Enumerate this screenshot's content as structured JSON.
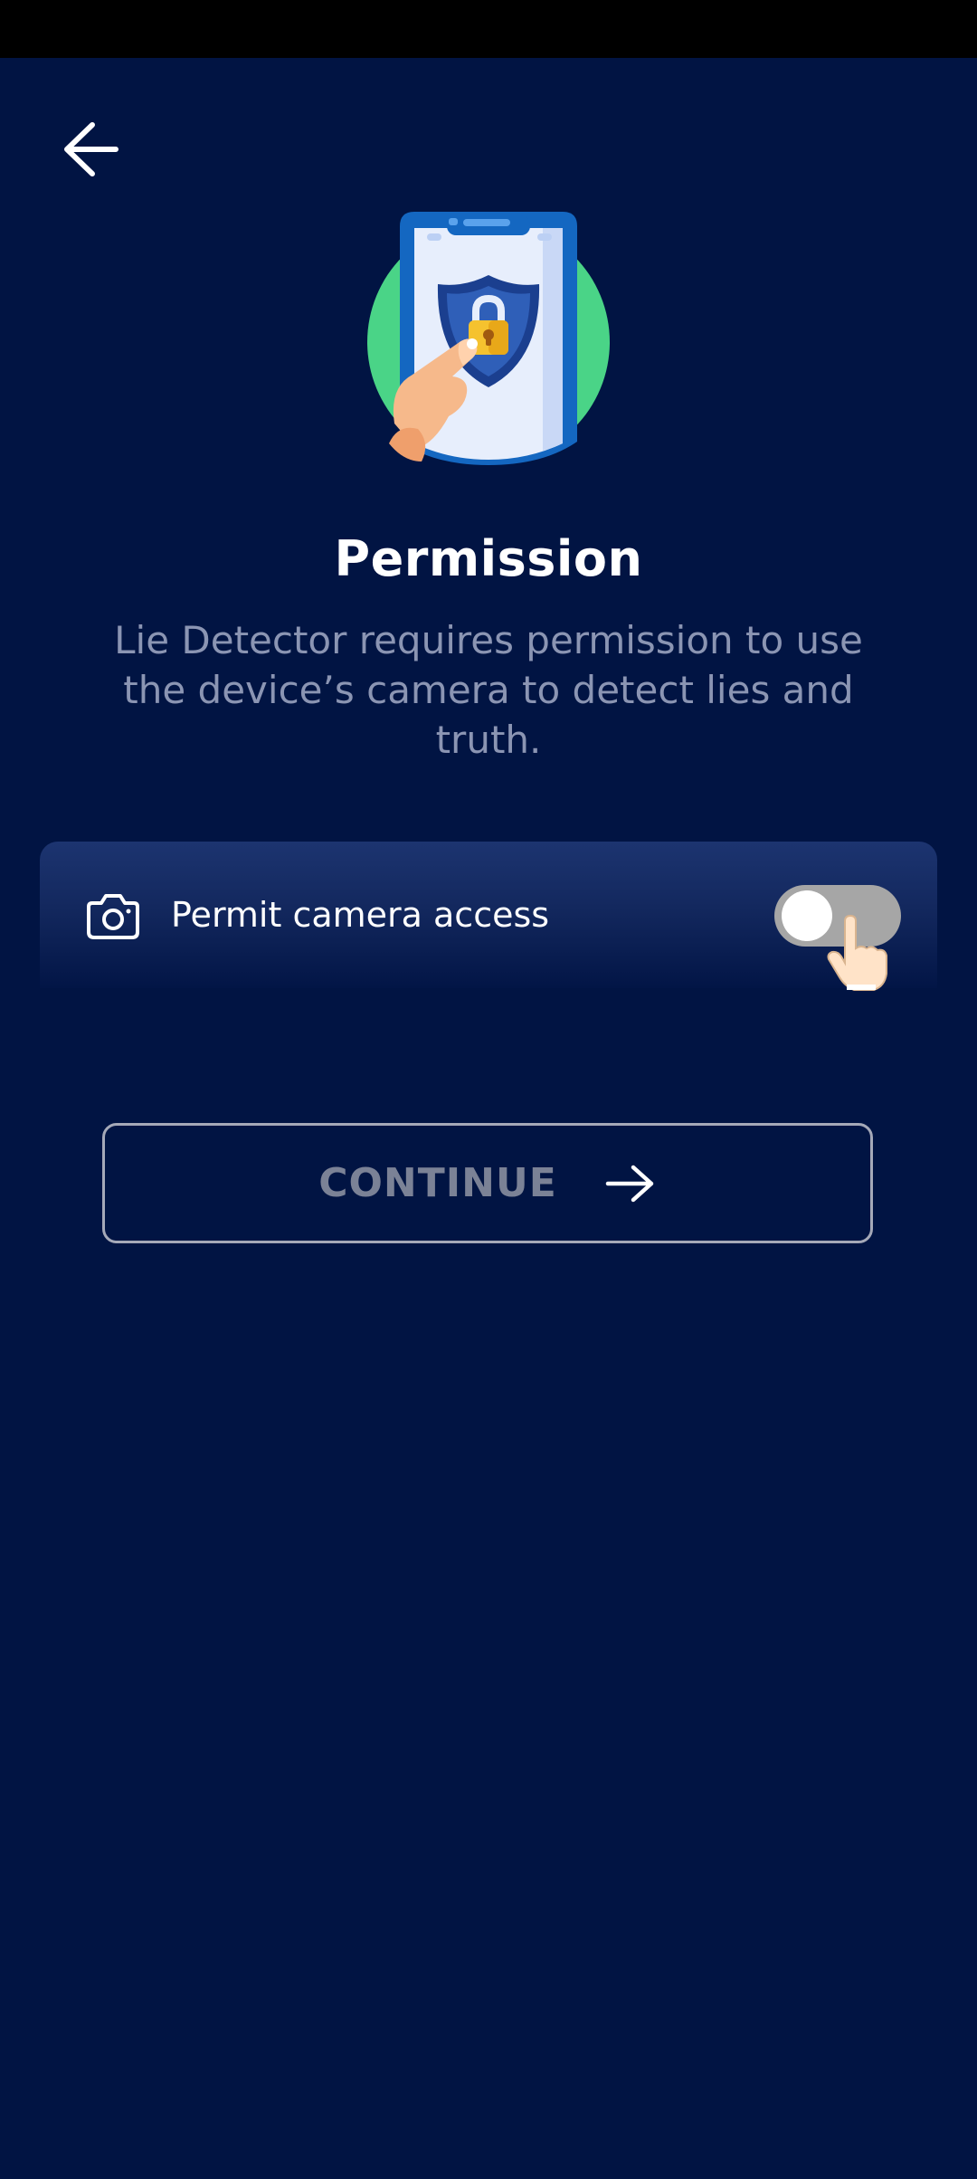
{
  "screen": {
    "title": "Permission",
    "description": "Lie Detector requires permission to use the device’s camera to detect lies and truth."
  },
  "permission": {
    "label": "Permit camera access",
    "icon": "camera-icon",
    "toggle_on": false
  },
  "continue_button": {
    "label": "CONTINUE",
    "icon": "arrow-right-icon"
  },
  "navigation": {
    "back_icon": "arrow-left-icon"
  },
  "colors": {
    "background": "#011443",
    "accent_green": "#4ad487",
    "toggle_off": "#a6a6a6",
    "button_border": "#a5a9b8",
    "button_text": "#7b8296",
    "description_text": "#8b95b3"
  }
}
